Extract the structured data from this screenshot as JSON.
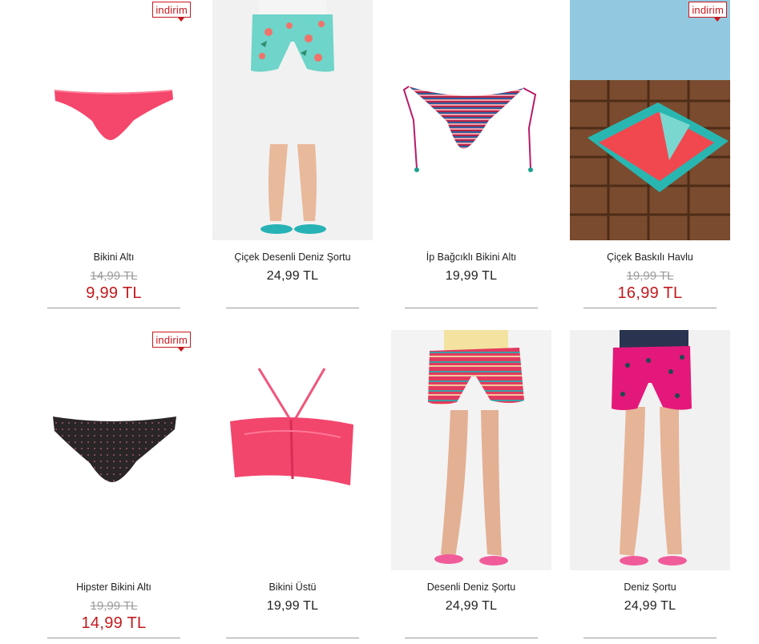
{
  "products": [
    {
      "name": "Bikini Altı",
      "badge": "indirim",
      "old_price": "14,99 TL",
      "price": "9,99 TL",
      "icon": "pink-bikini-bottom"
    },
    {
      "name": "Çiçek Desenli Deniz Şortu",
      "price": "24,99 TL",
      "icon": "floral-swim-shorts"
    },
    {
      "name": "İp Bağcıklı Bikini Altı",
      "price": "19,99 TL",
      "icon": "striped-string-bikini-bottom"
    },
    {
      "name": "Çiçek Baskılı Havlu",
      "badge": "indirim",
      "old_price": "19,99 TL",
      "price": "16,99 TL",
      "icon": "printed-towel"
    },
    {
      "name": "Hipster Bikini Altı",
      "badge": "indirim",
      "old_price": "19,99 TL",
      "price": "14,99 TL",
      "icon": "dotted-hipster-bikini-bottom"
    },
    {
      "name": "Bikini Üstü",
      "price": "19,99 TL",
      "icon": "pink-bandeau-bikini-top"
    },
    {
      "name": "Desenli Deniz Şortu",
      "price": "24,99 TL",
      "icon": "patterned-swim-shorts"
    },
    {
      "name": "Deniz Şortu",
      "price": "24,99 TL",
      "icon": "pink-swim-shorts"
    }
  ],
  "colors": {
    "sale_red": "#c11a1e",
    "badge_red": "#c8191e",
    "old_price_gray": "#9a9a9a"
  }
}
